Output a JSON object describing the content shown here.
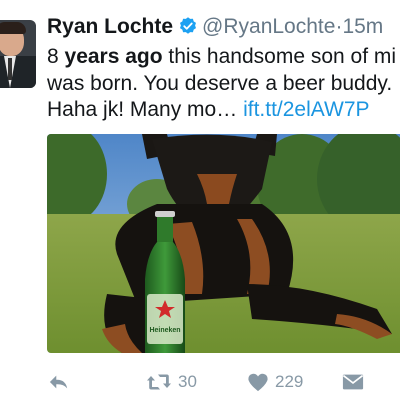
{
  "tweet": {
    "author_name": "Ryan Lochte",
    "author_handle": "@RyanLochte",
    "separator": "·",
    "timestamp": "15m",
    "text_lines": [
      {
        "pre": "8 ",
        "bold": "years ago",
        "post": " this handsome son of mi"
      },
      {
        "pre": "was born. You deserve a beer buddy."
      },
      {
        "pre": "Haha jk! Many mo… ",
        "link": "ift.tt/2elAW7P"
      }
    ],
    "media": {
      "bottle_label": "Heineken"
    }
  },
  "actions": {
    "retweet_count": "30",
    "like_count": "229"
  },
  "icons": {
    "reply": "reply-icon",
    "retweet": "retweet-icon",
    "like": "heart-icon",
    "dm": "envelope-icon",
    "verified": "verified-badge-icon"
  },
  "colors": {
    "link": "#1b95e0",
    "verified": "#1da1f2",
    "muted": "#657786",
    "action": "#8899a6"
  }
}
